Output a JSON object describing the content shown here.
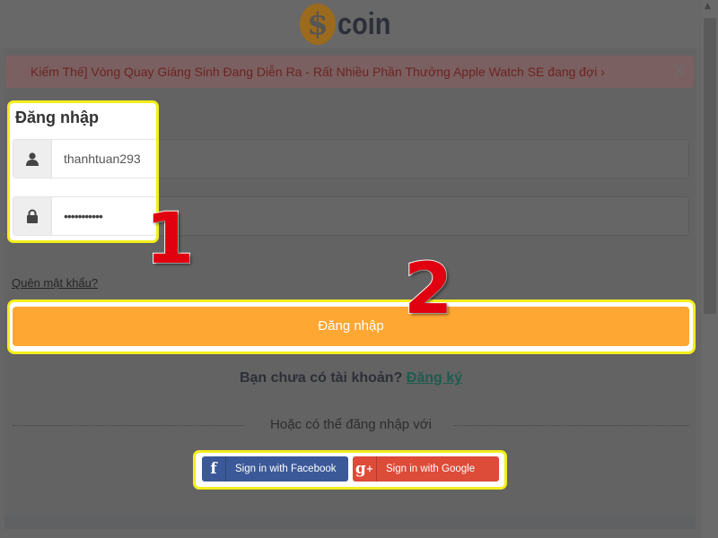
{
  "logo": {
    "symbol": "$",
    "text": "coin"
  },
  "alert": {
    "text": "Kiếm Thế] Vòng Quay Giáng Sinh Đang Diễn Ra - Rất Nhiều Phần Thưởng Apple Watch SE đang đợi ›",
    "close": "X"
  },
  "login": {
    "title": "Đăng nhập",
    "username": "thanhtuan293",
    "password": "•••••••••••",
    "forgot": "Quên mật khẩu?",
    "submit": "Đăng nhập",
    "no_account": "Bạn chưa có tài khoản?",
    "register": "Đăng ký",
    "or_text": "Hoặc có thể đăng nhập với",
    "facebook": "Sign in with Facebook",
    "google": "Sign in with Google"
  },
  "annotations": {
    "step1": "1",
    "step2": "2"
  },
  "colors": {
    "highlight": "#f3ee1c",
    "primary": "#ffa733",
    "facebook": "#3b5998",
    "google": "#dd4b39",
    "annotation": "#e0000f"
  }
}
